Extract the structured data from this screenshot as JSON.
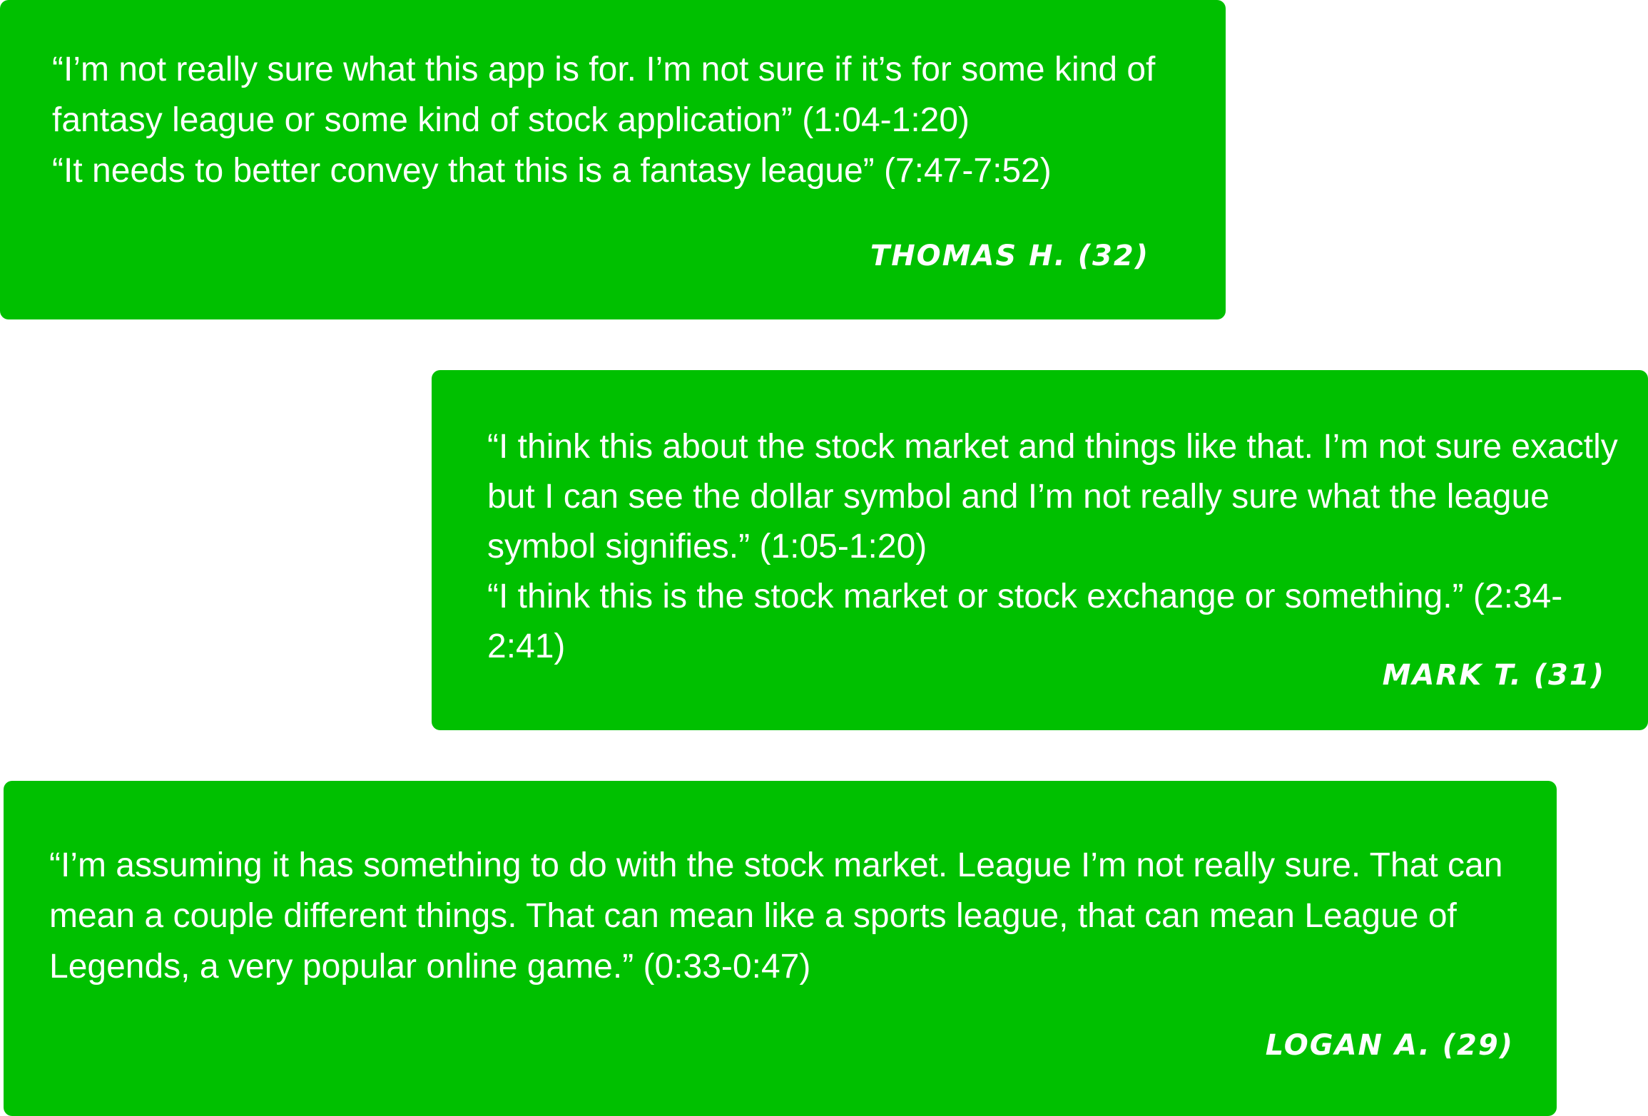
{
  "testimonials": [
    {
      "quote_lines": [
        "“I’m not really sure what this app is for. I’m not sure if it’s for some kind of fantasy league or some kind of stock application” (1:04-1:20)",
        "“It needs to better convey that this is a fantasy league” (7:47-7:52)"
      ],
      "author": "THOMAS H. (32)"
    },
    {
      "quote_lines": [
        "“I think this about the stock market and things like that. I’m not sure exactly but I can see the dollar symbol and I’m not really sure what the league symbol signifies.” (1:05-1:20)",
        "“I think this is the stock market or stock exchange or something.” (2:34-2:41)"
      ],
      "author": "MARK T. (31)"
    },
    {
      "quote_lines": [
        "“I’m assuming it has something to do with the stock market. League I’m not really sure. That can mean a couple different things. That can mean like a sports league, that can mean League of Legends, a very popular online game.” (0:33-0:47)"
      ],
      "author": "LOGAN A. (29)"
    }
  ],
  "colors": {
    "card_background": "#00c000",
    "text": "#ffffff",
    "page_background": "#ffffff"
  }
}
